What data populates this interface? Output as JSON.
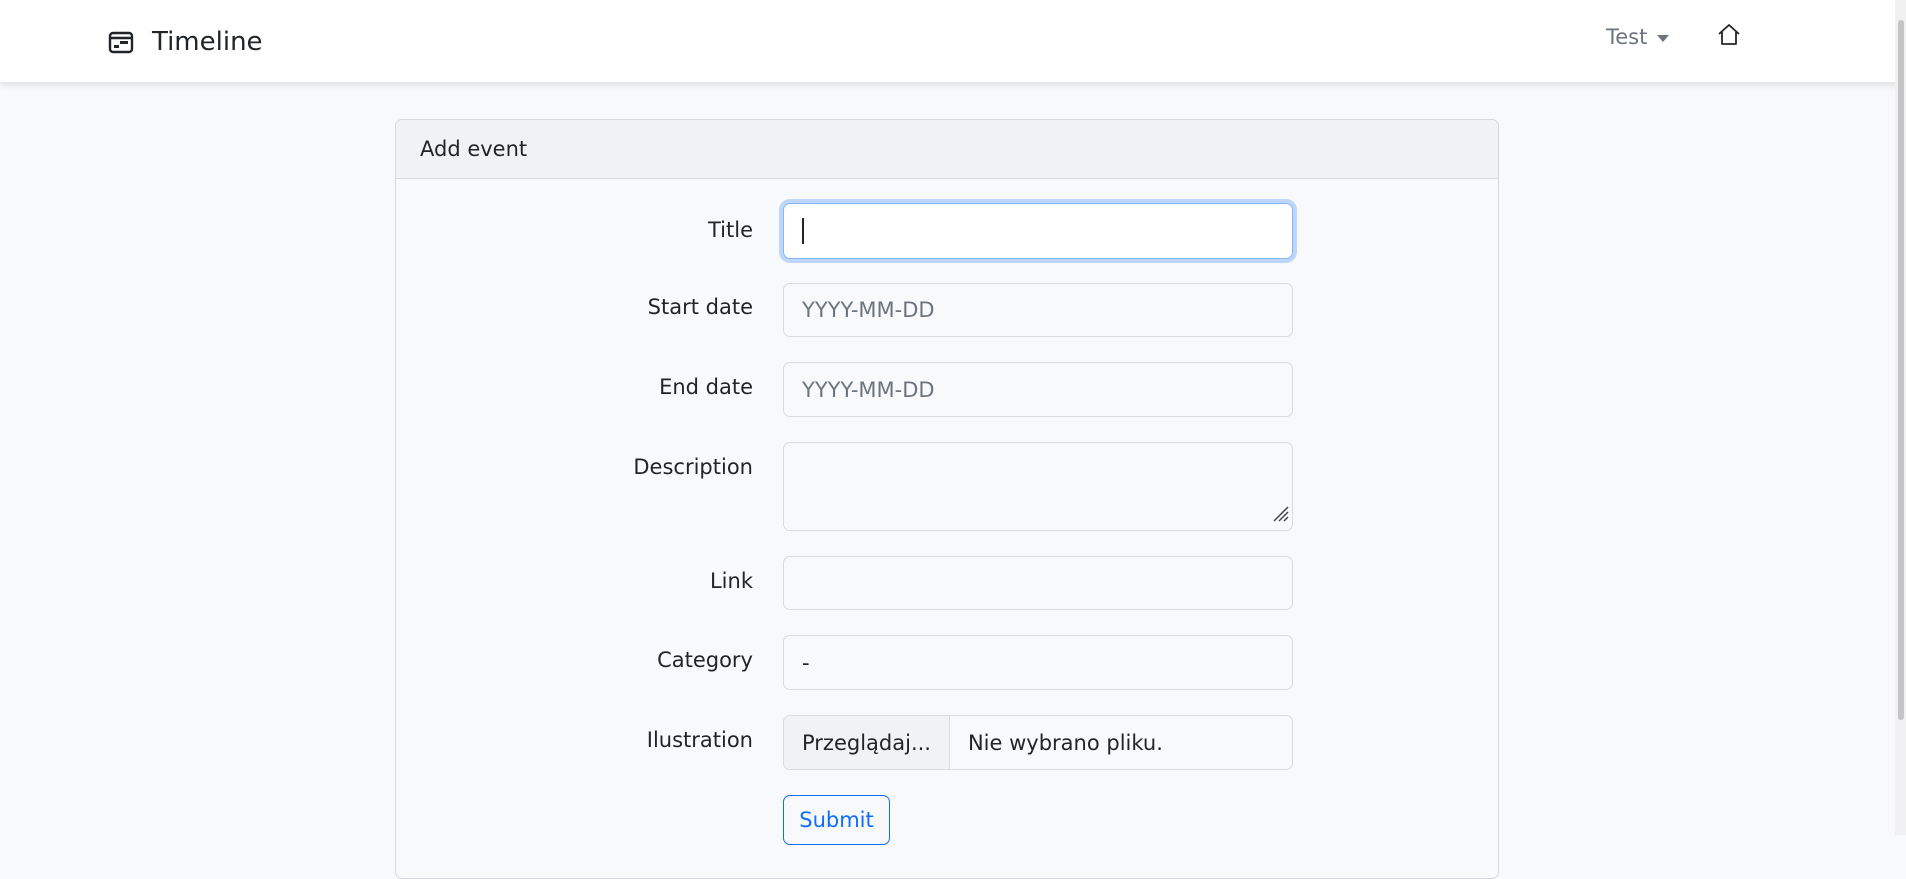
{
  "navbar": {
    "brand_title": "Timeline",
    "brand_icon": "calendar-card-icon",
    "user_menu_label": "Test",
    "home_icon": "home-icon"
  },
  "form": {
    "card_title": "Add event",
    "fields": {
      "title": {
        "label": "Title",
        "value": ""
      },
      "start_date": {
        "label": "Start date",
        "placeholder": "YYYY-MM-DD"
      },
      "end_date": {
        "label": "End date",
        "placeholder": "YYYY-MM-DD"
      },
      "description": {
        "label": "Description",
        "value": ""
      },
      "link": {
        "label": "Link",
        "value": ""
      },
      "category": {
        "label": "Category",
        "selected": "-"
      },
      "illustration": {
        "label": "Ilustration",
        "browse_label": "Przeglądaj...",
        "file_status": "Nie wybrano pliku."
      }
    },
    "submit_label": "Submit"
  },
  "colors": {
    "accent": "#0d6efd",
    "focus_ring": "#86b7fe",
    "background": "#f8f9fa"
  }
}
